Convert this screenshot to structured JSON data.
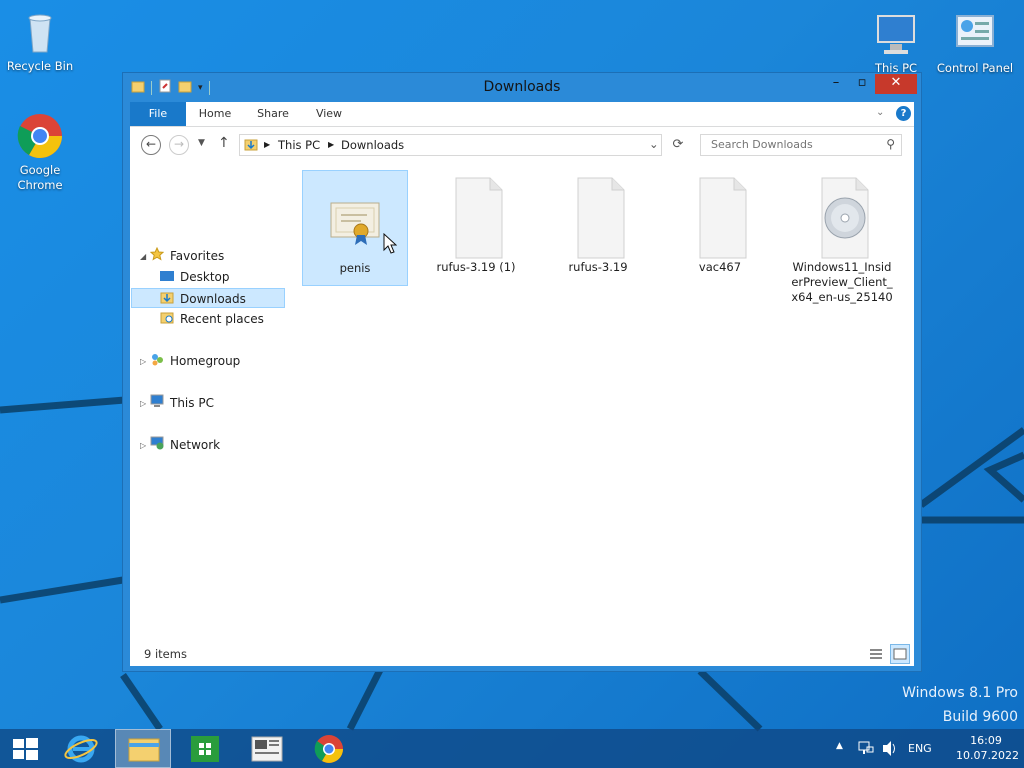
{
  "desktop": {
    "icons": [
      {
        "label": "Recycle Bin",
        "icon": "recycle-bin-icon"
      },
      {
        "label": "Google Chrome",
        "icon": "chrome-icon"
      },
      {
        "label": "This PC",
        "icon": "computer-icon"
      },
      {
        "label": "Control Panel",
        "icon": "control-panel-icon"
      }
    ],
    "watermark": {
      "line1": "Windows 8.1 Pro",
      "line2": "Build 9600"
    }
  },
  "window": {
    "title": "Downloads",
    "controls": {
      "minimize": "–",
      "maximize": "▫",
      "close": "✕"
    },
    "ribbon_tabs": [
      "File",
      "Home",
      "Share",
      "View"
    ],
    "address": {
      "crumbs": [
        "This PC",
        "Downloads"
      ]
    },
    "search": {
      "placeholder": "Search Downloads"
    },
    "nav": {
      "favorites": "Favorites",
      "favorites_items": [
        "Desktop",
        "Downloads",
        "Recent places"
      ],
      "homegroup": "Homegroup",
      "this_pc": "This PC",
      "network": "Network"
    },
    "files": [
      {
        "name": "penis",
        "icon": "certificate-icon",
        "selected": true
      },
      {
        "name": "rufus-3.19 (1)",
        "icon": "blank-file-icon",
        "selected": false
      },
      {
        "name": "rufus-3.19",
        "icon": "blank-file-icon",
        "selected": false
      },
      {
        "name": "vac467",
        "icon": "blank-file-icon",
        "selected": false
      },
      {
        "name": "Windows11_InsiderPreview_Client_x64_en-us_25140",
        "icon": "disc-image-icon",
        "selected": false
      }
    ],
    "status": {
      "item_count": "9 items"
    }
  },
  "taskbar": {
    "apps": [
      "start-icon",
      "internet-explorer-icon",
      "file-explorer-icon",
      "store-icon",
      "news-icon",
      "chrome-icon"
    ],
    "tray": {
      "language": "ENG",
      "time": "16:09",
      "date": "10.07.2022"
    }
  },
  "colors": {
    "accent": "#1979ca",
    "close": "#c7392b",
    "selection": "#cce8ff",
    "desktop": "#1a8ee6"
  }
}
